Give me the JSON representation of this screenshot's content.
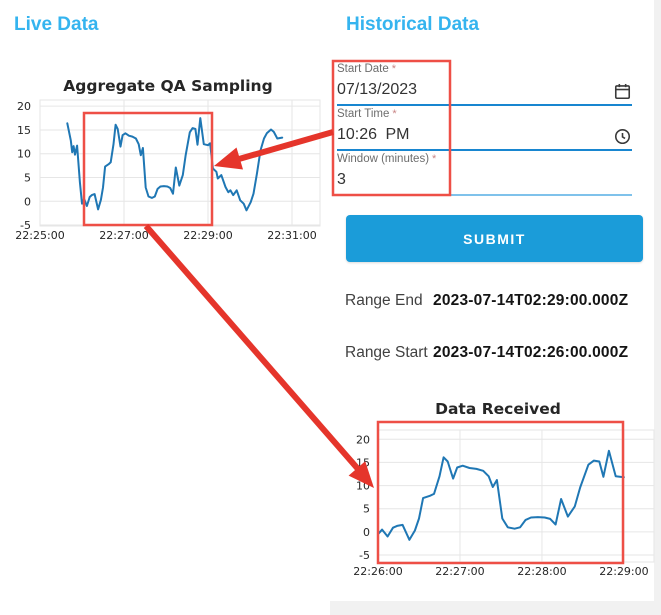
{
  "live_panel": {
    "title": "Live Data"
  },
  "historical_panel": {
    "title": "Historical Data"
  },
  "form": {
    "fields": [
      {
        "label": "Start Date",
        "required_marker": "*",
        "value": "07/13/2023",
        "icon": "calendar-icon"
      },
      {
        "label": "Start Time",
        "required_marker": "*",
        "value": "10:26 PM",
        "icon": "clock-icon"
      },
      {
        "label": "Window (minutes)",
        "required_marker": "*",
        "value": "3",
        "icon": ""
      }
    ],
    "submit_label": "SUBMIT"
  },
  "results": [
    {
      "label": "Range End",
      "value": "2023-07-14T02:29:00.000Z"
    },
    {
      "label": "Range Start",
      "value": "2023-07-14T02:26:00.000Z"
    }
  ],
  "colors": {
    "panel_title_blue": "#35b4ef",
    "button_blue": "#1b9cd9",
    "underline_blue": "#1886d0",
    "underline_light_blue": "#7fc2eb",
    "chart_line_blue": "#1f77b4",
    "annotation_red": "#e5352b",
    "annotation_box_red": "#ee4f46"
  },
  "chart_data": [
    {
      "type": "line",
      "title": "Aggregate QA Sampling",
      "x_unit": "seconds after 22:25:00",
      "xlim": [
        0,
        400
      ],
      "ylim": [
        -5.2,
        21.3
      ],
      "grid": true,
      "line_color": "#1f77b4",
      "x_ticks": [
        {
          "t": 0,
          "label": "22:25:00"
        },
        {
          "t": 120,
          "label": "22:27:00"
        },
        {
          "t": 240,
          "label": "22:29:00"
        },
        {
          "t": 360,
          "label": "22:31:00"
        }
      ],
      "y_ticks": [
        20,
        15,
        10,
        5,
        0,
        -5
      ],
      "points": [
        [
          39,
          16.4
        ],
        [
          44,
          12.8
        ],
        [
          46,
          10.3
        ],
        [
          48,
          11.6
        ],
        [
          50,
          9.8
        ],
        [
          53,
          11.7
        ],
        [
          57,
          4
        ],
        [
          60,
          -0.5
        ],
        [
          63,
          0.5
        ],
        [
          67,
          -1
        ],
        [
          71,
          0.9
        ],
        [
          74,
          1.3
        ],
        [
          78,
          1.5
        ],
        [
          83,
          -1.7
        ],
        [
          87,
          0.3
        ],
        [
          90,
          2.9
        ],
        [
          93,
          7.3
        ],
        [
          98,
          7.8
        ],
        [
          101,
          8.2
        ],
        [
          105,
          12
        ],
        [
          108,
          16.1
        ],
        [
          111,
          15.2
        ],
        [
          115,
          11.5
        ],
        [
          118,
          13.9
        ],
        [
          122,
          14.3
        ],
        [
          127,
          13.8
        ],
        [
          132,
          13.6
        ],
        [
          137,
          13.2
        ],
        [
          141,
          12
        ],
        [
          144,
          9.7
        ],
        [
          147,
          11.2
        ],
        [
          151,
          2.9
        ],
        [
          155,
          1
        ],
        [
          160,
          0.7
        ],
        [
          164,
          1
        ],
        [
          168,
          2.6
        ],
        [
          172,
          3.1
        ],
        [
          177,
          3.2
        ],
        [
          182,
          3.1
        ],
        [
          186,
          2.8
        ],
        [
          190,
          1.6
        ],
        [
          194,
          7.1
        ],
        [
          199,
          3.3
        ],
        [
          204,
          5.5
        ],
        [
          208,
          9.6
        ],
        [
          214,
          14.5
        ],
        [
          218,
          15.4
        ],
        [
          222,
          15.2
        ],
        [
          225,
          11.9
        ],
        [
          229,
          17.5
        ],
        [
          234,
          12
        ],
        [
          240,
          11.8
        ],
        [
          243,
          12.2
        ],
        [
          247,
          6.9
        ],
        [
          252,
          6.2
        ],
        [
          254,
          4.8
        ],
        [
          259,
          5.5
        ],
        [
          265,
          3
        ],
        [
          269,
          1.9
        ],
        [
          272,
          2.3
        ],
        [
          276,
          1.3
        ],
        [
          281,
          2.3
        ],
        [
          286,
          0.2
        ],
        [
          291,
          -0.5
        ],
        [
          295,
          -1.9
        ],
        [
          301,
          -0.2
        ],
        [
          305,
          1.6
        ],
        [
          310,
          5.9
        ],
        [
          315,
          10.7
        ],
        [
          320,
          13.2
        ],
        [
          324,
          14.3
        ],
        [
          330,
          15.1
        ],
        [
          334,
          14.6
        ],
        [
          339,
          13.2
        ],
        [
          346,
          13.4
        ]
      ]
    },
    {
      "type": "line",
      "title": "Data Received",
      "x_unit": "seconds after 22:26:00",
      "xlim": [
        0,
        202
      ],
      "ylim": [
        -6.5,
        22
      ],
      "grid": true,
      "line_color": "#1f77b4",
      "x_ticks": [
        {
          "t": 0,
          "label": "22:26:00"
        },
        {
          "t": 60,
          "label": "22:27:00"
        },
        {
          "t": 120,
          "label": "22:28:00"
        },
        {
          "t": 180,
          "label": "22:29:00"
        }
      ],
      "y_ticks": [
        20,
        15,
        10,
        5,
        0,
        -5
      ],
      "points": [
        [
          0,
          -0.5
        ],
        [
          3,
          0.5
        ],
        [
          7,
          -1
        ],
        [
          11,
          0.9
        ],
        [
          14,
          1.3
        ],
        [
          18,
          1.5
        ],
        [
          23,
          -1.7
        ],
        [
          27,
          0.3
        ],
        [
          30,
          2.9
        ],
        [
          33,
          7.3
        ],
        [
          38,
          7.8
        ],
        [
          41,
          8.2
        ],
        [
          45,
          12
        ],
        [
          48,
          16.1
        ],
        [
          51,
          15.2
        ],
        [
          55,
          11.5
        ],
        [
          58,
          13.9
        ],
        [
          62,
          14.3
        ],
        [
          67,
          13.8
        ],
        [
          72,
          13.6
        ],
        [
          77,
          13.2
        ],
        [
          81,
          12
        ],
        [
          84,
          9.7
        ],
        [
          87,
          11.2
        ],
        [
          91,
          2.9
        ],
        [
          95,
          1
        ],
        [
          100,
          0.7
        ],
        [
          104,
          1
        ],
        [
          108,
          2.6
        ],
        [
          112,
          3.1
        ],
        [
          117,
          3.2
        ],
        [
          122,
          3.1
        ],
        [
          126,
          2.8
        ],
        [
          130,
          1.6
        ],
        [
          134,
          7.1
        ],
        [
          139,
          3.3
        ],
        [
          144,
          5.5
        ],
        [
          148,
          9.6
        ],
        [
          154,
          14.5
        ],
        [
          158,
          15.4
        ],
        [
          162,
          15.2
        ],
        [
          165,
          11.9
        ],
        [
          169,
          17.5
        ],
        [
          174,
          12
        ],
        [
          180,
          11.8
        ]
      ]
    }
  ]
}
